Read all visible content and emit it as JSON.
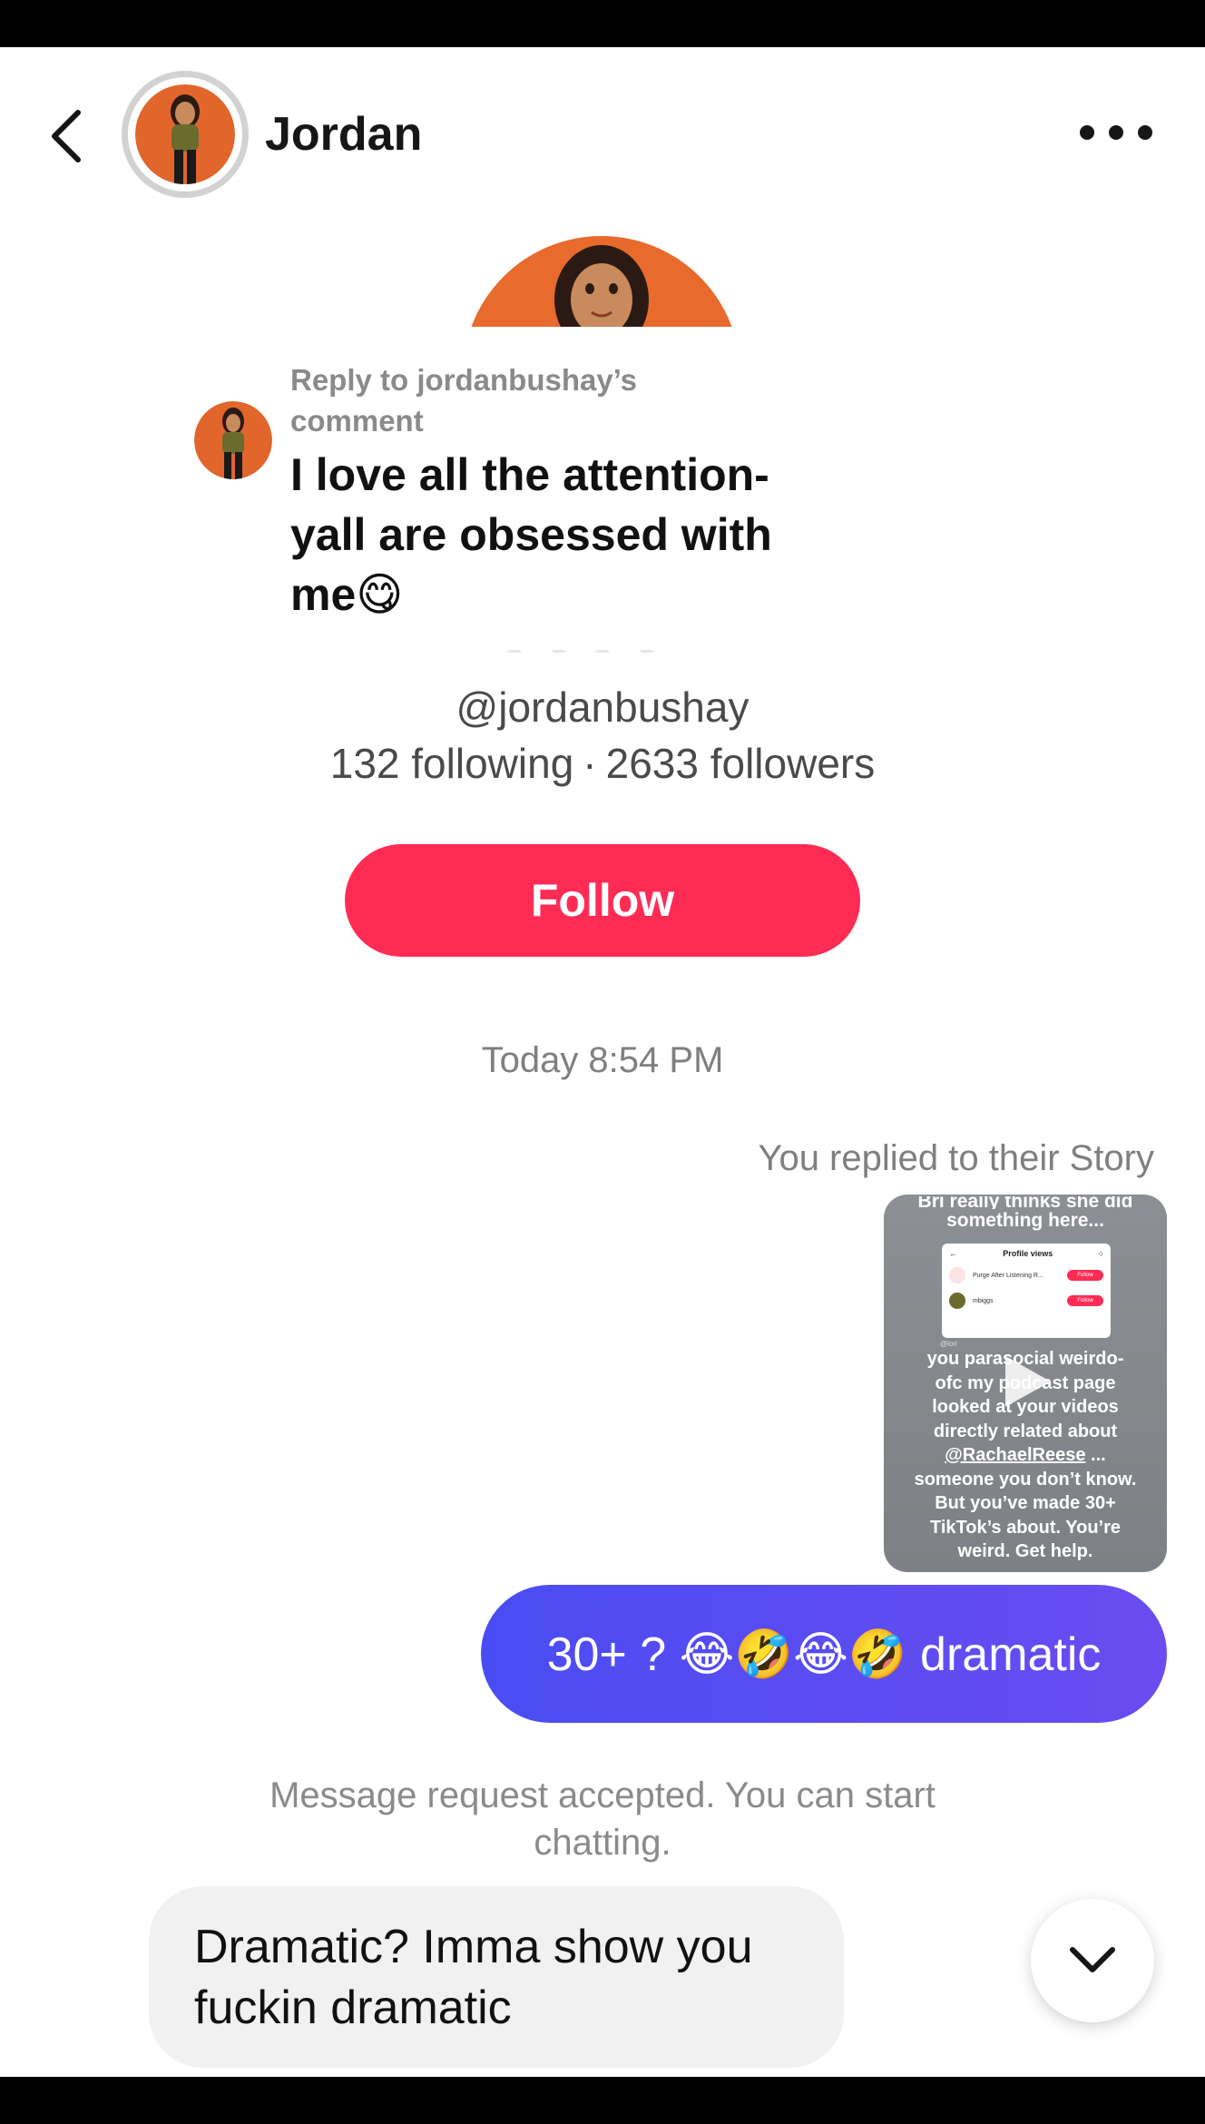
{
  "header": {
    "title": "Jordan",
    "back_icon": "chevron-left-icon",
    "more_icon": "more-horizontal-icon"
  },
  "reply": {
    "label": "Reply to jordanbushay’s comment",
    "comment": "I love all the attention- yall are obsessed with me😋"
  },
  "profile": {
    "handle": "@jordanbushay",
    "following": "132 following",
    "separator": "·",
    "followers": "2633 followers",
    "follow_label": "Follow"
  },
  "chat": {
    "timestamp": "Today 8:54 PM",
    "story_note": "You replied to their Story",
    "story": {
      "top_text_clipped": "Bri really thinks she did",
      "top_text": "something here...",
      "panel_title": "Profile views",
      "panel_row1": "Purge After Listening R...",
      "panel_row2": "mbiggs",
      "panel_pill": "Follow",
      "small_label": "@lori",
      "body_line1": "you parasocial weirdo-",
      "body_line2": "ofc my podcast page",
      "body_line3": "looked at your videos",
      "body_line4": "directly related about",
      "mention": "@RachaelReese",
      "mention_suffix": " ...",
      "body_line6": "someone you don’t know.",
      "body_line7": "But you’ve made 30+",
      "body_line8": "TikTok’s about. You’re",
      "body_line9": "weird. Get help."
    },
    "sent_message": "30+ ? 😂🤣😂🤣 dramatic",
    "system_message": "Message request accepted. You can start chatting.",
    "received_message": "Dramatic? Imma show you fuckin dramatic"
  },
  "colors": {
    "follow": "#fe2c55",
    "sent_bubble": "#5a4cf2",
    "received_bubble": "#f1f1f2",
    "muted_text": "#7f7f7f"
  }
}
